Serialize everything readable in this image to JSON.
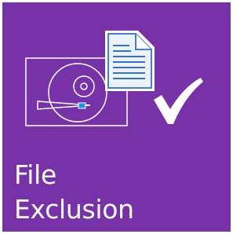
{
  "tile": {
    "label_line1": "File",
    "label_line2": "Exclusion",
    "background_color": "#7732a8",
    "accent_color": "#1e96e6",
    "icons": [
      "hard-drive-icon",
      "document-icon",
      "checkmark-icon"
    ]
  }
}
